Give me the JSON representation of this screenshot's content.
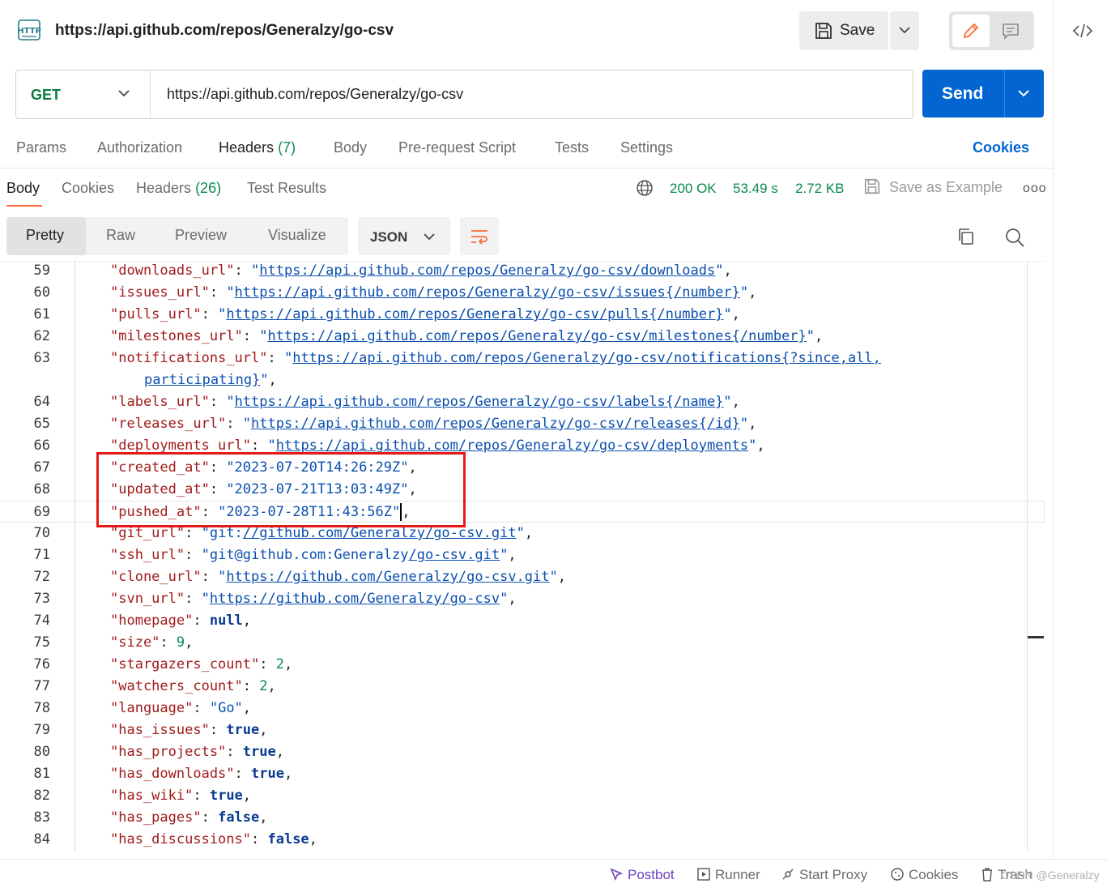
{
  "request": {
    "title": "https://api.github.com/repos/Generalzy/go-csv",
    "save_label": "Save",
    "method": "GET",
    "url": "https://api.github.com/repos/Generalzy/go-csv",
    "send_label": "Send"
  },
  "request_tabs": [
    {
      "label": "Params"
    },
    {
      "label": "Authorization"
    },
    {
      "label": "Headers",
      "count": "(7)"
    },
    {
      "label": "Body"
    },
    {
      "label": "Pre-request Script"
    },
    {
      "label": "Tests"
    },
    {
      "label": "Settings"
    }
  ],
  "cookies_link": "Cookies",
  "response_tabs": [
    {
      "label": "Body"
    },
    {
      "label": "Cookies"
    },
    {
      "label": "Headers",
      "count": "(26)"
    },
    {
      "label": "Test Results"
    }
  ],
  "response_meta": {
    "status": "200 OK",
    "time": "53.49 s",
    "size": "2.72 KB",
    "save_example": "Save as Example",
    "more": "ooo"
  },
  "view_modes": [
    "Pretty",
    "Raw",
    "Preview",
    "Visualize"
  ],
  "format": "JSON",
  "code_lines": [
    {
      "ln": "59",
      "k": "downloads_url",
      "v": "https://api.github.com/repos/Generalzy/go-csv/downloads",
      "t": "url"
    },
    {
      "ln": "60",
      "k": "issues_url",
      "v": "https://api.github.com/repos/Generalzy/go-csv/issues{/number}",
      "t": "url"
    },
    {
      "ln": "61",
      "k": "pulls_url",
      "v": "https://api.github.com/repos/Generalzy/go-csv/pulls{/number}",
      "t": "url"
    },
    {
      "ln": "62",
      "k": "milestones_url",
      "v": "https://api.github.com/repos/Generalzy/go-csv/milestones{/number}",
      "t": "url"
    },
    {
      "ln": "63",
      "k": "notifications_url",
      "v": "https://api.github.com/repos/Generalzy/go-csv/notifications{?since,all,",
      "t": "url"
    },
    {
      "ln": "",
      "cont": "participating}",
      "t": "url"
    },
    {
      "ln": "64",
      "k": "labels_url",
      "v": "https://api.github.com/repos/Generalzy/go-csv/labels{/name}",
      "t": "url"
    },
    {
      "ln": "65",
      "k": "releases_url",
      "v": "https://api.github.com/repos/Generalzy/go-csv/releases{/id}",
      "t": "url"
    },
    {
      "ln": "66",
      "k": "deployments_url",
      "v": "https://api.github.com/repos/Generalzy/go-csv/deployments",
      "t": "url"
    },
    {
      "ln": "67",
      "k": "created_at",
      "v": "2023-07-20T14:26:29Z",
      "t": "str"
    },
    {
      "ln": "68",
      "k": "updated_at",
      "v": "2023-07-21T13:03:49Z",
      "t": "str"
    },
    {
      "ln": "69",
      "k": "pushed_at",
      "v": "2023-07-28T11:43:56Z",
      "t": "str",
      "current": true
    },
    {
      "ln": "70",
      "k": "git_url",
      "v": "git://github.com/Generalzy/go-csv.git",
      "t": "giturl"
    },
    {
      "ln": "71",
      "k": "ssh_url",
      "v": "git@github.com:Generalzy/go-csv.git",
      "t": "sshurl"
    },
    {
      "ln": "72",
      "k": "clone_url",
      "v": "https://github.com/Generalzy/go-csv.git",
      "t": "url"
    },
    {
      "ln": "73",
      "k": "svn_url",
      "v": "https://github.com/Generalzy/go-csv",
      "t": "url"
    },
    {
      "ln": "74",
      "k": "homepage",
      "v": "null",
      "t": "lit"
    },
    {
      "ln": "75",
      "k": "size",
      "v": "9",
      "t": "num"
    },
    {
      "ln": "76",
      "k": "stargazers_count",
      "v": "2",
      "t": "num"
    },
    {
      "ln": "77",
      "k": "watchers_count",
      "v": "2",
      "t": "num"
    },
    {
      "ln": "78",
      "k": "language",
      "v": "Go",
      "t": "str"
    },
    {
      "ln": "79",
      "k": "has_issues",
      "v": "true",
      "t": "lit"
    },
    {
      "ln": "80",
      "k": "has_projects",
      "v": "true",
      "t": "lit"
    },
    {
      "ln": "81",
      "k": "has_downloads",
      "v": "true",
      "t": "lit"
    },
    {
      "ln": "82",
      "k": "has_wiki",
      "v": "true",
      "t": "lit"
    },
    {
      "ln": "83",
      "k": "has_pages",
      "v": "false",
      "t": "lit"
    },
    {
      "ln": "84",
      "k": "has_discussions",
      "v": "false",
      "t": "lit"
    }
  ],
  "statusbar": {
    "postbot": "Postbot",
    "runner": "Runner",
    "start_proxy": "Start Proxy",
    "cookies": "Cookies",
    "trash": "Trash",
    "watermark": "CSDN @Generalzy"
  },
  "colors": {
    "accent": "#ff6c37",
    "send": "#0265d2",
    "method_get": "#0a7d3e",
    "status_ok": "#0a8a4a",
    "highlight_box": "#e61919"
  }
}
